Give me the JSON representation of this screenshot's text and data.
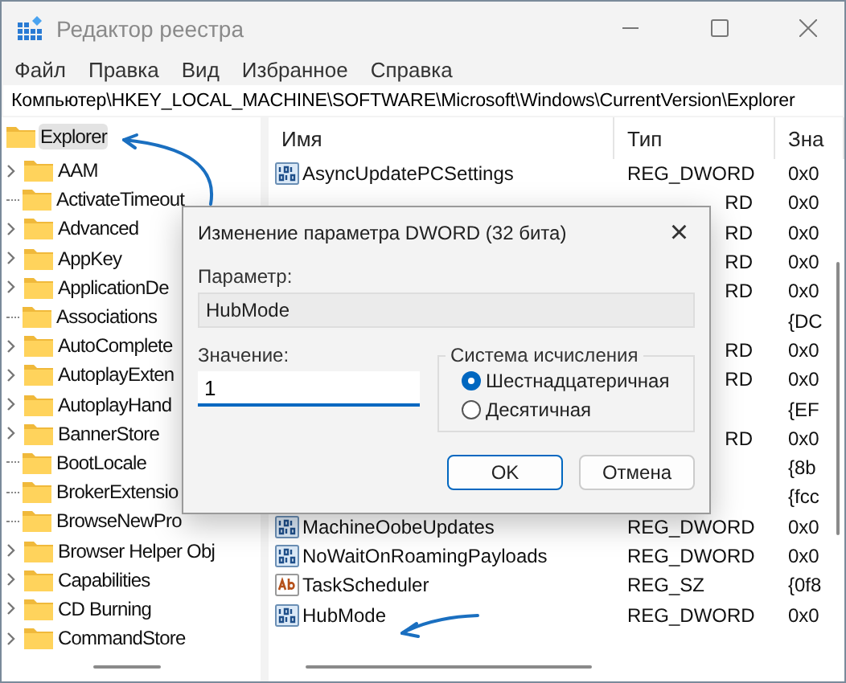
{
  "window": {
    "title": "Редактор реестра"
  },
  "menu": [
    "Файл",
    "Правка",
    "Вид",
    "Избранное",
    "Справка"
  ],
  "address": "Компьютер\\HKEY_LOCAL_MACHINE\\SOFTWARE\\Microsoft\\Windows\\CurrentVersion\\Explorer",
  "tree": {
    "items": [
      {
        "label": "Explorer",
        "selected": true,
        "children": [
          {
            "label": "AAM",
            "expandable": true,
            "selected": false
          },
          {
            "label": "ActivateTimeout",
            "expandable": false,
            "selected": false
          },
          {
            "label": "Advanced",
            "expandable": true,
            "selected": false
          },
          {
            "label": "AppKey",
            "expandable": true,
            "selected": false
          },
          {
            "label": "ApplicationDe",
            "expandable": true,
            "selected": false
          },
          {
            "label": "Associations",
            "expandable": false,
            "selected": false
          },
          {
            "label": "AutoComplete",
            "expandable": true,
            "selected": false
          },
          {
            "label": "AutoplayExten",
            "expandable": true,
            "selected": false
          },
          {
            "label": "AutoplayHand",
            "expandable": true,
            "selected": false
          },
          {
            "label": "BannerStore",
            "expandable": true,
            "selected": false
          },
          {
            "label": "BootLocale",
            "expandable": false,
            "selected": false
          },
          {
            "label": "BrokerExtensio",
            "expandable": false,
            "selected": false
          },
          {
            "label": "BrowseNewPro",
            "expandable": false,
            "selected": false
          },
          {
            "label": "Browser Helper Obj",
            "expandable": true,
            "selected": false
          },
          {
            "label": "Capabilities",
            "expandable": true,
            "selected": false
          },
          {
            "label": "CD Burning",
            "expandable": true,
            "selected": false
          },
          {
            "label": "CommandStore",
            "expandable": true,
            "selected": false
          }
        ]
      }
    ]
  },
  "table": {
    "columns": [
      "Имя",
      "Тип",
      "Зна"
    ],
    "rows": [
      {
        "kind": "dword",
        "name": "AsyncUpdatePCSettings",
        "type": "REG_DWORD",
        "value": "0x0"
      },
      {
        "kind": "covered",
        "type": "RD",
        "value": "0x0"
      },
      {
        "kind": "covered",
        "type": "RD",
        "value": "0x0"
      },
      {
        "kind": "covered",
        "type": "RD",
        "value": "0x0"
      },
      {
        "kind": "covered",
        "type": "RD",
        "value": "0x0"
      },
      {
        "kind": "covered",
        "value": "{DC"
      },
      {
        "kind": "covered",
        "type": "RD",
        "value": "0x0"
      },
      {
        "kind": "covered",
        "type": "RD",
        "value": "0x0"
      },
      {
        "kind": "covered",
        "value": "{EF"
      },
      {
        "kind": "covered",
        "type": "RD",
        "value": "0x0"
      },
      {
        "kind": "covered",
        "value": "{8b"
      },
      {
        "kind": "covered",
        "value": "{fcc"
      },
      {
        "kind": "dword",
        "name": "MachineOobeUpdates",
        "type": "REG_DWORD",
        "value": "0x0"
      },
      {
        "kind": "dword",
        "name": "NoWaitOnRoamingPayloads",
        "type": "REG_DWORD",
        "value": "0x0"
      },
      {
        "kind": "string",
        "name": "TaskScheduler",
        "type": "REG_SZ",
        "value": "{0f8"
      },
      {
        "kind": "dword",
        "name": "HubMode",
        "type": "REG_DWORD",
        "value": "0x0"
      }
    ]
  },
  "dialog": {
    "title": "Изменение параметра DWORD (32 бита)",
    "close": "×",
    "name_label": "Параметр:",
    "name_value": "HubMode",
    "value_label": "Значение:",
    "value": "1",
    "base_group": "Система исчисления",
    "bases": [
      {
        "label": "Шестнадцатеричная",
        "selected": true
      },
      {
        "label": "Десятичная",
        "selected": false
      }
    ],
    "buttons": [
      {
        "label": "OK",
        "default": true
      },
      {
        "label": "Отмена",
        "default": false
      }
    ]
  }
}
